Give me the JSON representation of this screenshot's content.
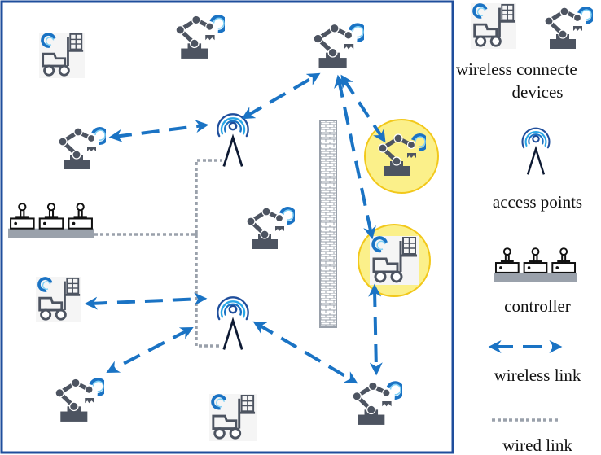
{
  "legend": {
    "devices_line1": "wireless connecte",
    "devices_line2": "devices",
    "access_points": "access points",
    "controller": "controller",
    "wireless_link": "wireless link",
    "wired_link": "wired link"
  },
  "colors": {
    "frame": "#1f4e9c",
    "wireless_link": "#1a73c4",
    "wired_link": "#9aa1ab",
    "device": "#4d5461",
    "highlight_fill": "#fbf08a",
    "highlight_stroke": "#f2c81b",
    "wall": "#9aa1ab"
  },
  "nodes": [
    {
      "id": "forklift-1",
      "type": "forklift"
    },
    {
      "id": "robot-1",
      "type": "robot"
    },
    {
      "id": "robot-2",
      "type": "robot"
    },
    {
      "id": "robot-3",
      "type": "robot"
    },
    {
      "id": "ap-1",
      "type": "access-point"
    },
    {
      "id": "robot-yellow",
      "type": "robot",
      "highlighted": true
    },
    {
      "id": "forklift-yellow",
      "type": "forklift",
      "highlighted": true
    },
    {
      "id": "controller",
      "type": "controller"
    },
    {
      "id": "robot-4",
      "type": "robot"
    },
    {
      "id": "forklift-2",
      "type": "forklift"
    },
    {
      "id": "ap-2",
      "type": "access-point"
    },
    {
      "id": "robot-5",
      "type": "robot"
    },
    {
      "id": "forklift-3",
      "type": "forklift"
    },
    {
      "id": "robot-6",
      "type": "robot"
    }
  ],
  "wireless_links": [
    [
      "robot-3",
      "ap-1"
    ],
    [
      "ap-1",
      "robot-2"
    ],
    [
      "robot-2",
      "robot-yellow"
    ],
    [
      "robot-2",
      "forklift-yellow"
    ],
    [
      "forklift-yellow",
      "robot-6"
    ],
    [
      "forklift-2",
      "ap-2"
    ],
    [
      "ap-2",
      "robot-5"
    ],
    [
      "ap-2",
      "robot-6"
    ]
  ],
  "wired_links": [
    [
      "controller",
      "ap-1"
    ],
    [
      "controller",
      "ap-2"
    ]
  ]
}
